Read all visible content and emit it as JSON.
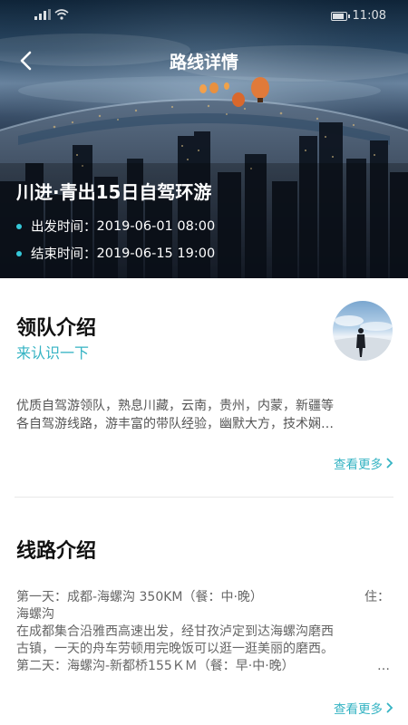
{
  "status_bar": {
    "time": "11:08"
  },
  "nav": {
    "title": "路线详情"
  },
  "hero": {
    "route_title": "川进·青出15日自驾环游",
    "start_label": "出发时间：",
    "start_time": "2019-06-01 08:00",
    "end_label": "结束时间：",
    "end_time": "2019-06-15 19:00"
  },
  "leader": {
    "title": "领队介绍",
    "subtitle": "来认识一下",
    "description_line1": "优质自驾游领队，熟息川藏，云南，贵州，内蒙，新疆等",
    "description_line2": "各自驾游线路，游丰富的带队经验，幽默大方，技术娴…",
    "more": "查看更多"
  },
  "route": {
    "title": "线路介绍",
    "day1": "第一天：成都-海螺沟 350KM（餐：中·晚）",
    "day1_stay_label": "住：",
    "day1_stay": "海螺沟",
    "desc_line1": "在成都集合沿雅西高速出发，经甘孜泸定到达海螺沟磨西",
    "desc_line2": "古镇，一天的舟车劳顿用完晚饭可以逛一逛美丽的磨西。",
    "day2": "第二天：海螺沟-新都桥155ＫＭ（餐：早·中·晚）",
    "day2_ellipsis": "…",
    "more": "查看更多"
  },
  "colors": {
    "accent": "#34b3c3",
    "dot": "#35c7d8"
  },
  "icons": [
    "signal-icon",
    "wifi-icon",
    "battery-icon",
    "back-arrow-icon",
    "chevron-right-icon"
  ]
}
